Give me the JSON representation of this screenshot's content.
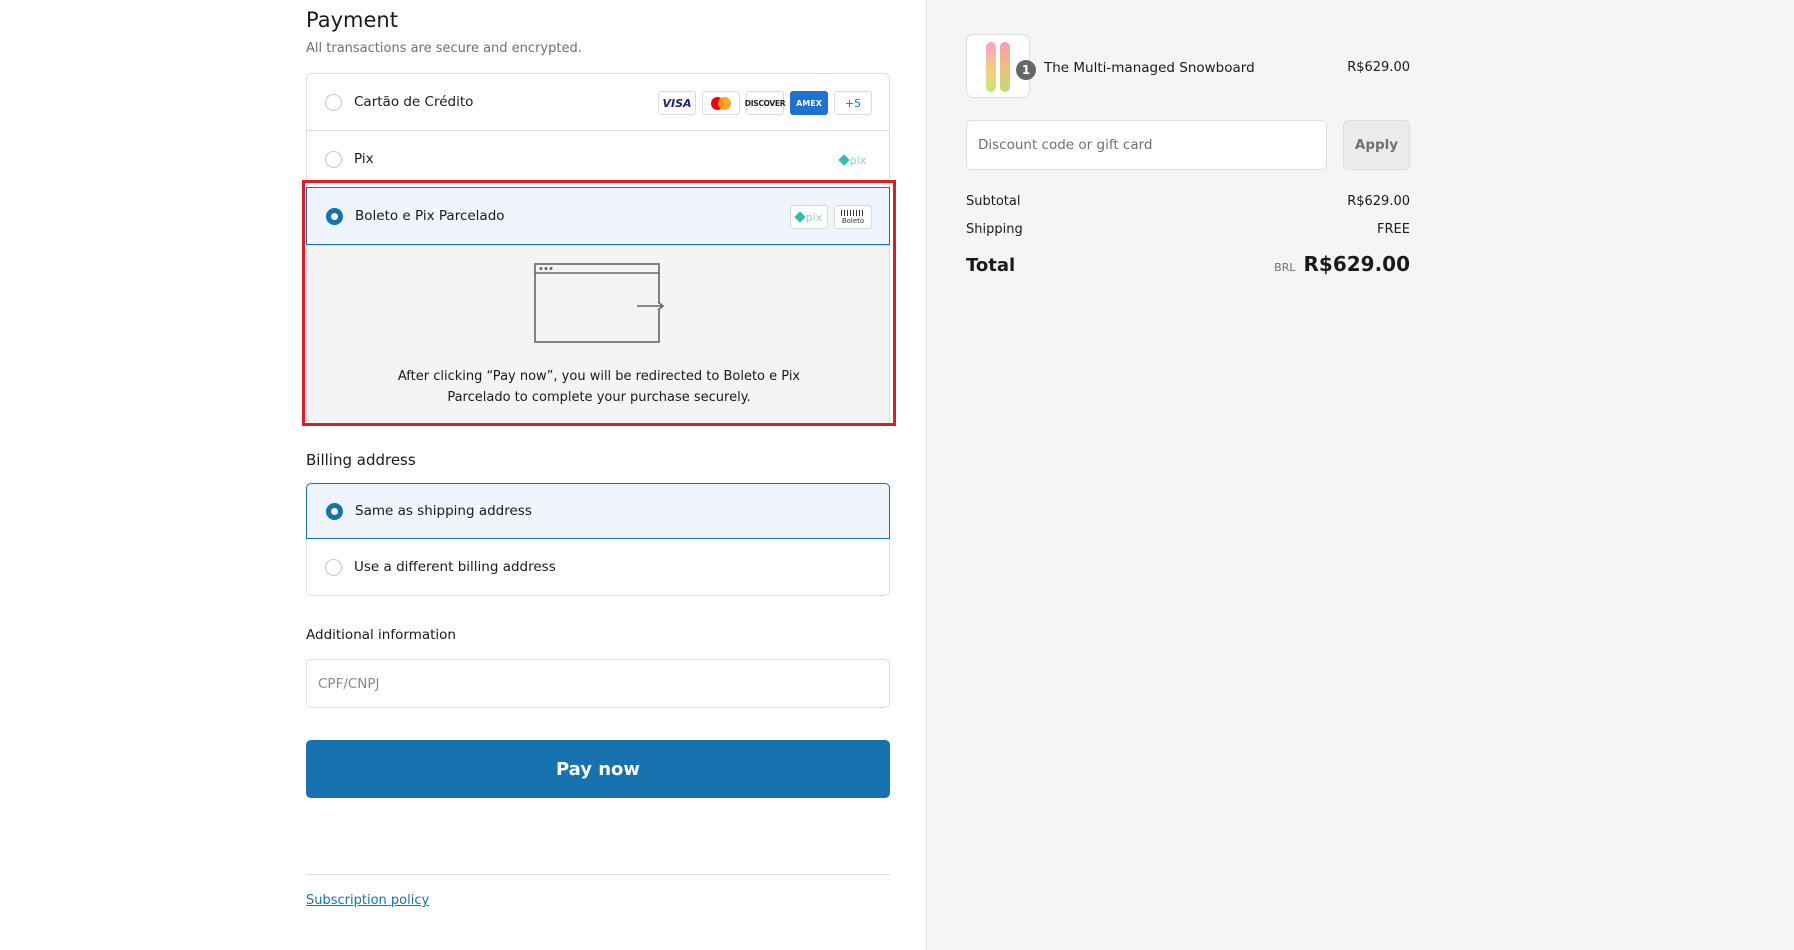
{
  "payment": {
    "title": "Payment",
    "subtitle": "All transactions are secure and encrypted.",
    "methods": [
      {
        "label": "Cartão de Crédito",
        "selected": false
      },
      {
        "label": "Pix",
        "selected": false
      },
      {
        "label": "Boleto e Pix Parcelado",
        "selected": true
      }
    ],
    "card_logos": [
      "VISA",
      "mastercard",
      "DISCOVER",
      "AMEX",
      "+5"
    ],
    "pix_logo_text": "pix",
    "boleto_logo_text": "Boleto",
    "redirect_message": "After clicking “Pay now”, you will be redirected to Boleto e Pix Parcelado to complete your purchase securely."
  },
  "billing": {
    "title": "Billing address",
    "options": [
      {
        "label": "Same as shipping address",
        "selected": true
      },
      {
        "label": "Use a different billing address",
        "selected": false
      }
    ]
  },
  "additional": {
    "title": "Additional information",
    "cpf_placeholder": "CPF/CNPJ",
    "cpf_value": ""
  },
  "pay_button": "Pay now",
  "footer": {
    "policy_link": "Subscription policy"
  },
  "summary": {
    "product": {
      "name": "The Multi-managed Snowboard",
      "price": "R$629.00",
      "quantity": "1"
    },
    "discount_placeholder": "Discount code or gift card",
    "apply_label": "Apply",
    "subtotal_label": "Subtotal",
    "subtotal_value": "R$629.00",
    "shipping_label": "Shipping",
    "shipping_value": "FREE",
    "total_label": "Total",
    "currency": "BRL",
    "total_value": "R$629.00"
  },
  "colors": {
    "accent": "#1773b0",
    "highlight": "#d9202a",
    "summary_bg": "#f5f5f5"
  }
}
